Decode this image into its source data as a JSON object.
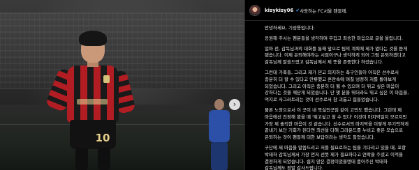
{
  "post": {
    "image": {
      "description_icon": "soccer-player-photo",
      "jersey_number": "10"
    },
    "nav": {
      "next_icon": "chevron-right-icon",
      "next_glyph": "›"
    },
    "author": {
      "username": "kisykisy06",
      "verified_icon": "verified-badge-icon",
      "header_caption": "사랑하는 FC서울 팬들께."
    },
    "caption": [
      "안녕하세요, 기성용입니다.",
      "응원해 주시는 팬분들을 생각하며 무겁고 죄송한 마음으로 글을 올립니다.",
      "얼마 전, 감독님과의 대화를 통해 앞으로 팀의 계획에 제가 없다는 것을 듣게 됐습니다. 이제 은퇴해야하는 시점이구나 생각하게 되어 그럼 은퇴하겠다고 감독님께 말씀드렸고 감독님께서 제 뜻을 존중한다 하셨습니다.",
      "그런데 가족들, 그리고 제가 믿고 의지하는 축구인들이 아직은 선수로서 충분히 더 할 수 있다고 만류했고 혼란속에 며칠 냉정히 저를 돌아보게 되었습니다. 그리고 아직은 충분히 더 뛸 수 있으며 더 뛰고 싶은 마음이 강하다는 것을 깨닫게 되었습니다. 단 몇 분을 뛰더라도 뛰고 싶은 이 마음을, 억지로 사그러트리는 것이 선수로서 참 괴롭고 힘들었습니다.",
      "물론 노장으로서 이 곳이 내 묵실인곳임 같이 고민도 했습니다. 그런데 제 마음에선 진정해 봤을 때 '뛰고싶고 할 수 있다' 이것이 마지막일지 모르지만 가장 제 솔직한 마음이 것 같습니다. 선수로서의 마지막을 이렇게 무기력하게 끝내기 보단 기회가 된다면 최선을 다해 그라운드를 누비고 좋은 모습으로 은퇴하는 것이 팬들께 대한 보답이라는 생각도 들었습니다.",
      "구단에 제 마음을 말씀드리고 저를 필요로하는 팀을 기다리고 있을 때, 포항 박태하 감독님께서 가장 먼저 선뜻 제가 필요하다고 연락을 주셨고 이적을 결정하게 되었습니다. 쉽지 않은 결정이었을텐데 품어주신 박태하 감독님께도 정말 감사드립니다."
    ]
  }
}
